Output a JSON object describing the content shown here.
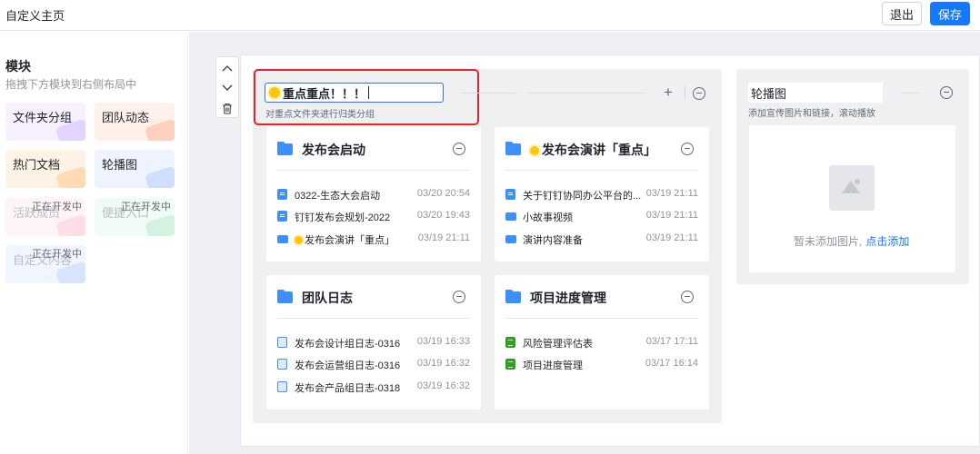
{
  "header": {
    "title": "自定义主页",
    "exit_label": "退出",
    "save_label": "保存"
  },
  "sidebar": {
    "heading": "模块",
    "hint": "拖拽下方模块到右侧布局中",
    "modules": [
      {
        "label": "文件夹分组",
        "status": ""
      },
      {
        "label": "团队动态",
        "status": ""
      },
      {
        "label": "热门文档",
        "status": ""
      },
      {
        "label": "轮播图",
        "status": ""
      },
      {
        "label": "活跃成员",
        "status": "正在开发中"
      },
      {
        "label": "便捷入口",
        "status": "正在开发中"
      },
      {
        "label": "自定义内容",
        "status": "正在开发中"
      }
    ]
  },
  "toolbar": {
    "icons": [
      "chevron-up-icon",
      "chevron-down-icon",
      "trash-icon"
    ]
  },
  "group": {
    "name": "重点重点！！！",
    "description": "对重点文件夹进行归类分组",
    "cards": [
      {
        "title": "发布会启动",
        "items": [
          {
            "type": "doc",
            "name": "0322-生态大会启动",
            "time": "03/20 20:54"
          },
          {
            "type": "doc",
            "name": "钉钉发布会规划-2022",
            "time": "03/20 19:43"
          },
          {
            "type": "folder",
            "name": "发布会演讲「重点」",
            "time": "03/19 21:11"
          }
        ]
      },
      {
        "title": "发布会演讲「重点」",
        "items": [
          {
            "type": "doc",
            "name": "关于钉钉协同办公平台的...",
            "time": "03/19 21:11"
          },
          {
            "type": "folder",
            "name": "小故事视频",
            "time": "03/19 21:11"
          },
          {
            "type": "folder",
            "name": "演讲内容准备",
            "time": "03/19 21:11"
          }
        ]
      },
      {
        "title": "团队日志",
        "items": [
          {
            "type": "log",
            "name": "发布会设计组日志-0316",
            "time": "03/19 16:33"
          },
          {
            "type": "log",
            "name": "发布会运营组日志-0316",
            "time": "03/19 16:32"
          },
          {
            "type": "log",
            "name": "发布会产品组日志-0318",
            "time": "03/19 16:32"
          }
        ]
      },
      {
        "title": "项目进度管理",
        "items": [
          {
            "type": "sheet",
            "name": "风险管理评估表",
            "time": "03/17 17:11"
          },
          {
            "type": "sheet",
            "name": "项目进度管理",
            "time": "03/17 16:14"
          }
        ]
      }
    ]
  },
  "carousel": {
    "name": "轮播图",
    "description": "添加宣传图片和链接，滚动播放",
    "empty_text": "暂未添加图片,",
    "add_link": "点击添加"
  },
  "colors": {
    "accent": "#1677ff",
    "highlight": "#e0262b",
    "folder": "#3d8eff"
  }
}
